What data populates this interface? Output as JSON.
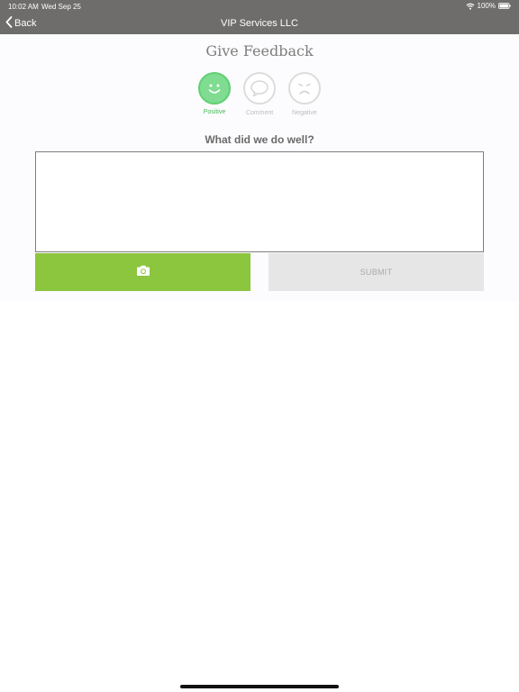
{
  "status_bar": {
    "time": "10:02 AM",
    "date": "Wed Sep 25",
    "battery": "100%",
    "icons": [
      "wifi-icon",
      "battery-icon"
    ]
  },
  "nav": {
    "back_label": "Back",
    "title": "VIP Services LLC"
  },
  "feedback": {
    "title": "Give Feedback",
    "ratings": [
      {
        "label": "Positive",
        "icon": "smiley-icon",
        "selected": true
      },
      {
        "label": "Comment",
        "icon": "speech-bubble-icon",
        "selected": false
      },
      {
        "label": "Negative",
        "icon": "frown-icon",
        "selected": false
      }
    ],
    "question": "What did we do well?",
    "input_value": "",
    "camera_icon": "camera-icon",
    "submit_label": "SUBMIT"
  },
  "colors": {
    "nav_bar": "#6e6d6b",
    "accent_green": "#8cc63f",
    "positive_green": "#7fdc91",
    "submit_disabled": "#e6e6e6"
  }
}
